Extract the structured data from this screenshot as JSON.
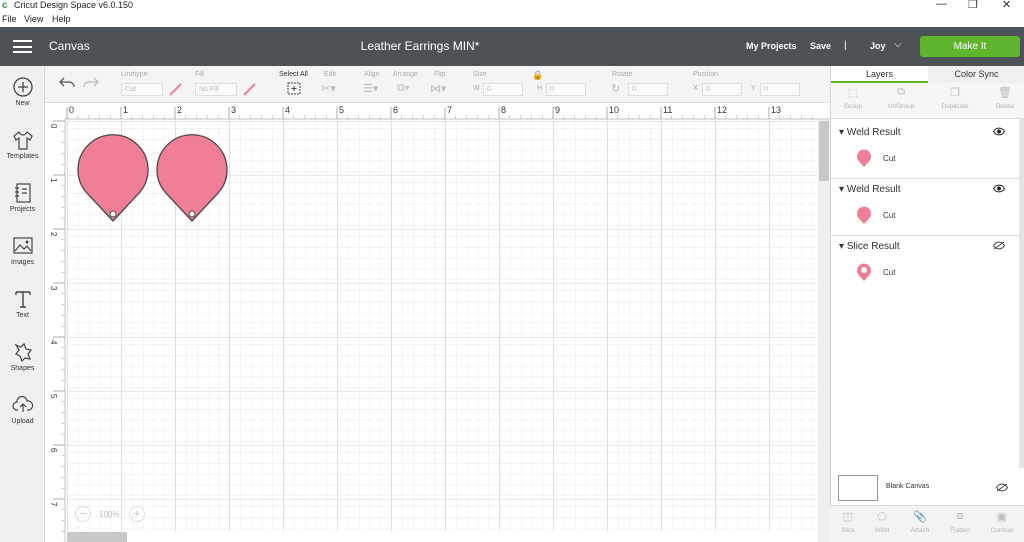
{
  "window": {
    "title": "Cricut Design Space  v6.0.150",
    "controls": {
      "minimize": "—",
      "maximize": "❐",
      "close": "✕"
    }
  },
  "menubar": {
    "items": [
      "File",
      "View",
      "Help"
    ]
  },
  "header": {
    "canvas_label": "Canvas",
    "document_title": "Leather Earrings MIN*",
    "my_projects": "My Projects",
    "save": "Save",
    "separator": "|",
    "user": "Joy",
    "make_it": "Make It"
  },
  "sidebar": {
    "items": [
      {
        "label": "New",
        "icon": "plus-circle-icon"
      },
      {
        "label": "Templates",
        "icon": "shirt-icon"
      },
      {
        "label": "Projects",
        "icon": "notebook-icon"
      },
      {
        "label": "Images",
        "icon": "image-icon"
      },
      {
        "label": "Text",
        "icon": "text-icon"
      },
      {
        "label": "Shapes",
        "icon": "shapes-icon"
      },
      {
        "label": "Upload",
        "icon": "cloud-upload-icon"
      }
    ]
  },
  "toolbar": {
    "linetype_label": "Linetype",
    "linetype_value": "Cut",
    "fill_label": "Fill",
    "fill_value": "No Fill",
    "select_all": "Select All",
    "edit": "Edit",
    "align": "Align",
    "arrange": "Arrange",
    "flip": "Flip",
    "size": "Size",
    "w_label": "W",
    "h_label": "H",
    "rotate": "Rotate",
    "position": "Position",
    "x_label": "X",
    "y_label": "Y",
    "zero": "0"
  },
  "ruler": {
    "x_ticks": [
      "0",
      "1",
      "2",
      "3",
      "4",
      "5",
      "6",
      "7",
      "8",
      "9",
      "10",
      "11",
      "12",
      "13"
    ],
    "y_ticks": [
      "0",
      "1",
      "2",
      "3",
      "4",
      "5",
      "6",
      "7"
    ]
  },
  "zoom": {
    "value": "100%",
    "minus": "−",
    "plus": "+"
  },
  "panel": {
    "tabs": [
      "Layers",
      "Color Sync"
    ],
    "actions": [
      "Group",
      "UnGroup",
      "Duplicate",
      "Delete"
    ],
    "layers": [
      {
        "name": "Weld Result",
        "operation": "Cut",
        "visible": true
      },
      {
        "name": "Weld Result",
        "operation": "Cut",
        "visible": true
      },
      {
        "name": "Slice Result",
        "operation": "Cut",
        "visible": false
      }
    ],
    "blank_canvas": "Blank Canvas",
    "bottom_actions": [
      "Slice",
      "Weld",
      "Attach",
      "Flatten",
      "Contour"
    ]
  },
  "colors": {
    "header": "#4d5257",
    "make_it": "#5fb52d",
    "shape_fill": "#f07e96",
    "shape_stroke": "#4a4a4a"
  }
}
